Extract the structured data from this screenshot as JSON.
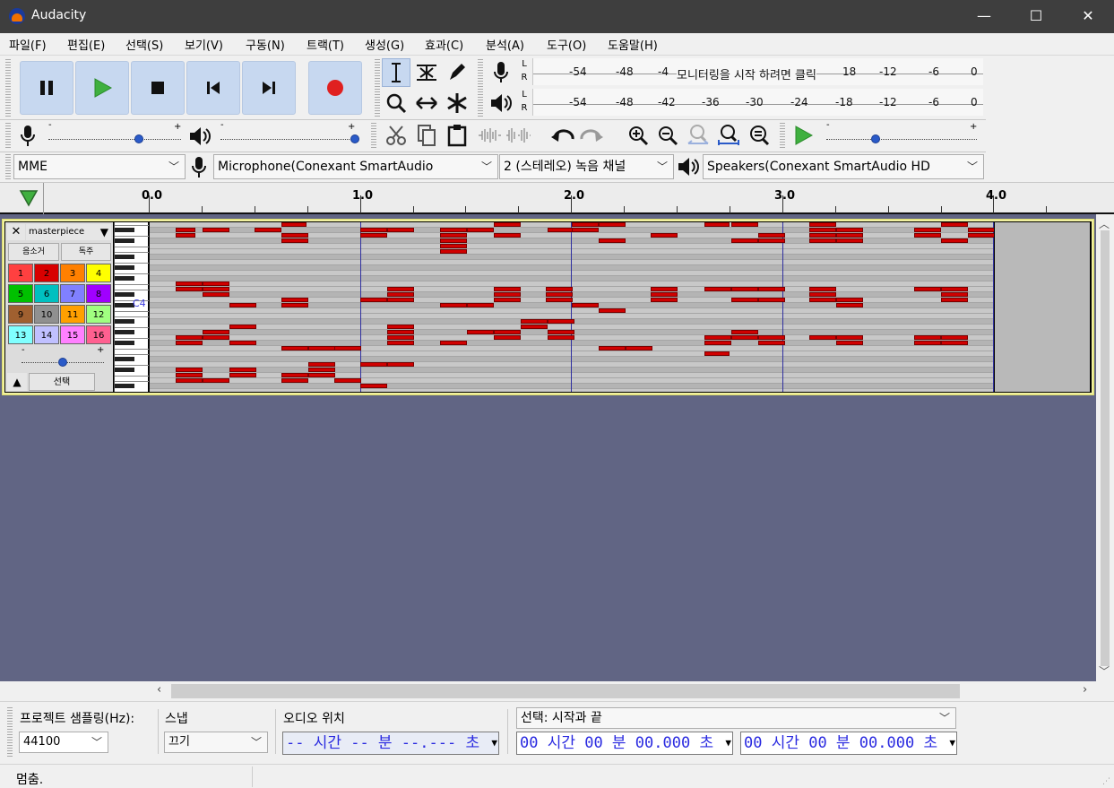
{
  "window": {
    "title": "Audacity",
    "minimize": "—",
    "maximize": "☐",
    "close": "✕"
  },
  "menu": [
    "파일(F)",
    "편집(E)",
    "선택(S)",
    "보기(V)",
    "구동(N)",
    "트랙(T)",
    "생성(G)",
    "효과(C)",
    "분석(A)",
    "도구(O)",
    "도움말(H)"
  ],
  "transport": {
    "buttons": [
      "pause",
      "play",
      "stop",
      "skip-to-start",
      "skip-to-end",
      "record"
    ]
  },
  "meters": {
    "record": {
      "channels": [
        "L",
        "R"
      ],
      "ticks": [
        "-54",
        "-48",
        "-4",
        "18",
        "-12",
        "-6",
        "0"
      ],
      "hint": "모니터링을 시작 하려면 클릭"
    },
    "playback": {
      "channels": [
        "L",
        "R"
      ],
      "ticks": [
        "-54",
        "-48",
        "-42",
        "-36",
        "-30",
        "-24",
        "-18",
        "-12",
        "-6",
        "0"
      ]
    }
  },
  "mixer": {
    "minus": "-",
    "plus": "+",
    "record_volume": 0.68,
    "playback_volume": 1.0,
    "play_at_speed": 0.33
  },
  "device": {
    "host": "MME",
    "input": "Microphone(Conexant SmartAudio",
    "channels": "2 (스테레오) 녹음 채널",
    "output": "Speakers(Conexant SmartAudio HD"
  },
  "ruler": {
    "labels": [
      "0.0",
      "1.0",
      "2.0",
      "3.0",
      "4.0"
    ]
  },
  "track": {
    "name": "masterpiece",
    "close": "✕",
    "mute": "음소거",
    "solo": "독주",
    "channels": [
      "1",
      "2",
      "3",
      "4",
      "5",
      "6",
      "7",
      "8",
      "9",
      "10",
      "11",
      "12",
      "13",
      "14",
      "15",
      "16"
    ],
    "channel_colors": [
      "#ff4040",
      "#d80000",
      "#ff8000",
      "#ffff00",
      "#00c000",
      "#00c0c0",
      "#8080ff",
      "#a000ff",
      "#a06030",
      "#909090",
      "#ffa000",
      "#a0ff80",
      "#80ffff",
      "#c0c0ff",
      "#ff80ff",
      "#ff6090"
    ],
    "velocity_minus": "-",
    "velocity_plus": "+",
    "velocity": 0.5,
    "select": "선택",
    "note_label": "C4",
    "collapse": "▲"
  },
  "selection_toolbar": {
    "rate_label": "프로젝트 샘플링(Hz):",
    "rate_value": "44100",
    "snap_label": "스냅",
    "snap_value": "끄기",
    "audio_pos_label": "오디오 위치",
    "audio_pos_value": "-- 시간 -- 분 --.--- 초",
    "selection_label": "선택: 시작과 끝",
    "sel_start": "00 시간 00 분 00.000 초",
    "sel_end": "00 시간 00 분 00.000 초"
  },
  "status": {
    "text": "멈춤."
  },
  "colors": {
    "record": "#e02020",
    "play": "#3fb03f",
    "note": "#d00000",
    "track_bg": "#616584"
  }
}
